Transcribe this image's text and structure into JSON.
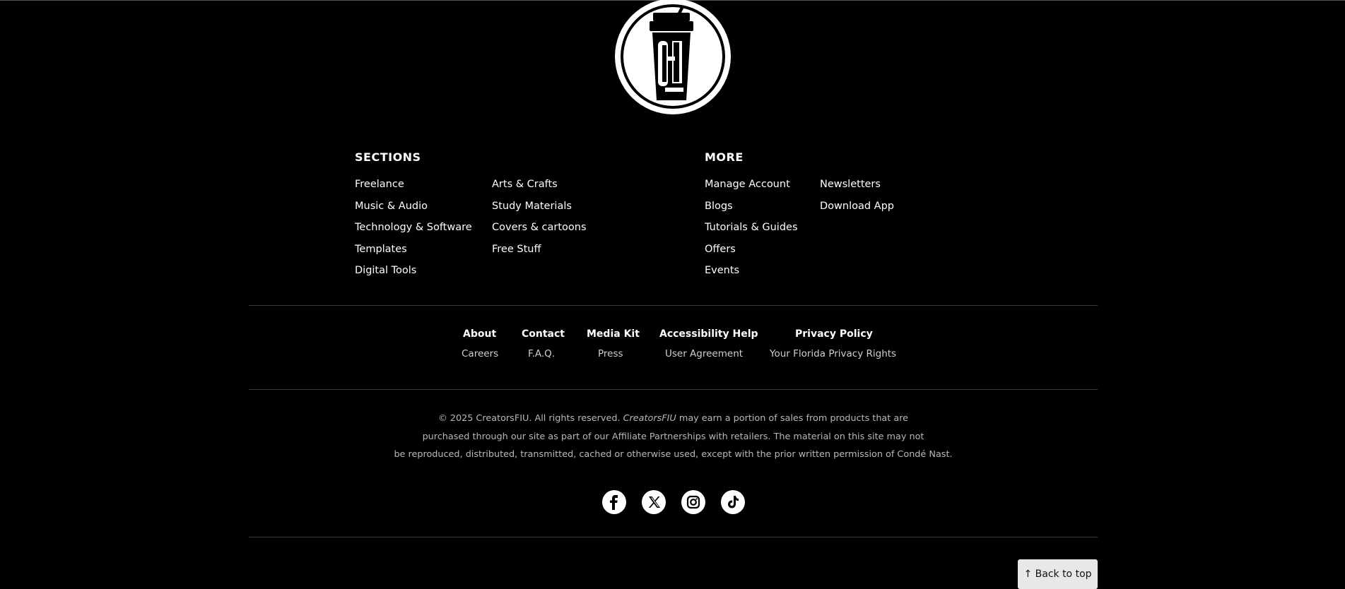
{
  "logo": {
    "icon": "cup-logo-icon"
  },
  "sections": {
    "heading": "SECTIONS",
    "column1": [
      "Freelance",
      "Music & Audio",
      "Technology & Software",
      "Templates",
      "Digital Tools"
    ],
    "column2": [
      "Arts & Crafts",
      "Study Materials",
      "Covers & cartoons",
      "Free Stuff"
    ]
  },
  "more": {
    "heading": "MORE",
    "column1": [
      "Manage Account",
      "Blogs",
      "Tutorials & Guides",
      "Offers",
      "Events"
    ],
    "column2": [
      "Newsletters",
      "Download App"
    ]
  },
  "footer_links": {
    "row1": [
      "About",
      "Contact",
      "Media Kit",
      "Accessibility Help",
      "Privacy Policy"
    ],
    "row2": [
      "Careers",
      "F.A.Q.",
      "Press",
      "User Agreement",
      "Your Florida Privacy Rights"
    ]
  },
  "legal": {
    "line1_a": "© 2025 CreatorsFIU. All rights reserved. ",
    "line1_brand": "CreatorsFIU",
    "line1_b": " may earn a portion of sales from products that are",
    "line2": "purchased through our site as part of our Affiliate Partnerships with retailers. The material on this site may not",
    "line3": "be reproduced, distributed, transmitted, cached or otherwise used, except with the prior written permission of Condé Nast."
  },
  "social": [
    "facebook-icon",
    "x-icon",
    "instagram-icon",
    "tiktok-icon"
  ],
  "back_to_top": "↑ Back to top",
  "colors": {
    "background": "#000000",
    "text": "#ffffff",
    "muted": "#b8b8b8",
    "button": "#e8e8e8"
  }
}
